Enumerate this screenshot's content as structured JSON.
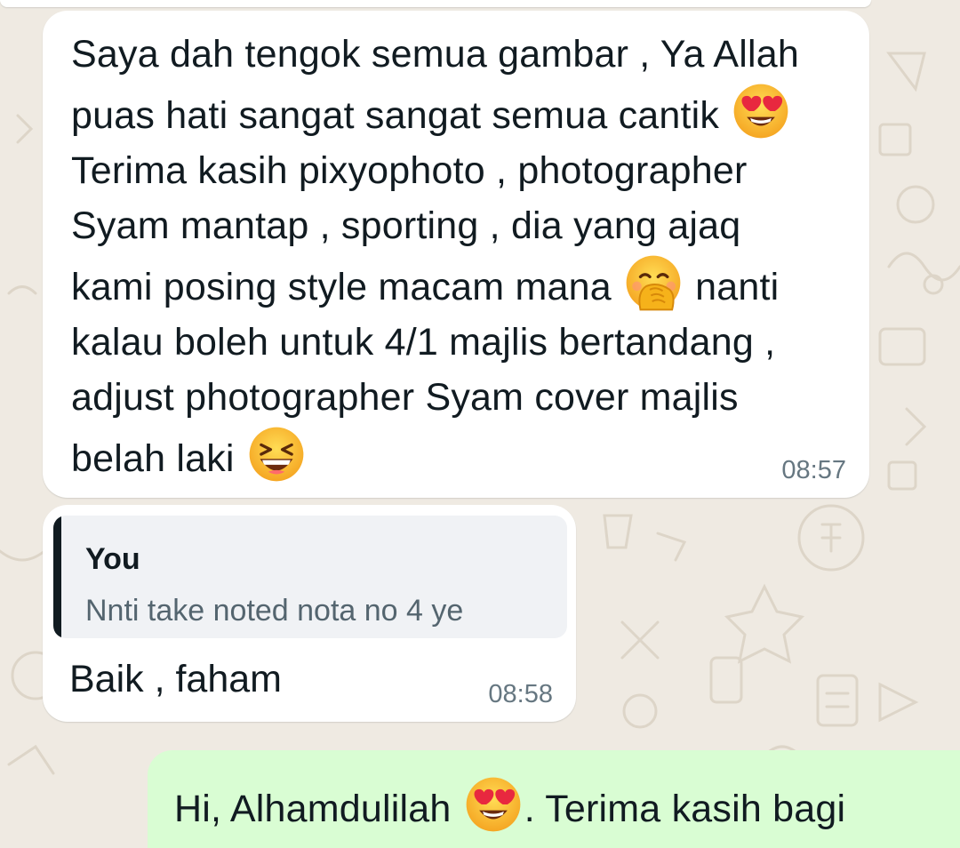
{
  "messages": [
    {
      "id": "incoming-1",
      "direction": "incoming",
      "lines": [
        {
          "before": "Saya dah tengok semua gambar , Ya Allah",
          "emoji": "",
          "after": ""
        },
        {
          "before": "puas hati sangat sangat semua cantik ",
          "emoji": "heart-eyes-emoji",
          "after": ""
        },
        {
          "before": "Terima kasih pixyophoto , photographer",
          "emoji": "",
          "after": ""
        },
        {
          "before": "Syam mantap , sporting , dia yang ajaq",
          "emoji": "",
          "after": ""
        },
        {
          "before": "kami posing style macam mana ",
          "emoji": "hand-over-mouth-emoji",
          "after": " nanti"
        },
        {
          "before": "kalau boleh untuk 4/1 majlis bertandang ,",
          "emoji": "",
          "after": ""
        },
        {
          "before": "adjust photographer Syam cover majlis",
          "emoji": "",
          "after": ""
        },
        {
          "before": "belah laki ",
          "emoji": "grinning-squinting-emoji",
          "after": ""
        }
      ],
      "time": "08:57"
    },
    {
      "id": "incoming-2",
      "direction": "incoming",
      "quoted": {
        "author": "You",
        "text": "Nnti take noted nota no 4 ye"
      },
      "text": "Baik , faham",
      "time": "08:58"
    },
    {
      "id": "outgoing-1",
      "direction": "outgoing",
      "before": "Hi, Alhamdulilah ",
      "emoji": "heart-eyes-emoji",
      "after": ". Terima kasih bagi"
    }
  ],
  "colors": {
    "wallpaper": "#efeae2",
    "incoming_bubble": "#ffffff",
    "outgoing_bubble": "#d9fdd3",
    "quote_background": "#f0f2f5",
    "timestamp": "#667781"
  }
}
